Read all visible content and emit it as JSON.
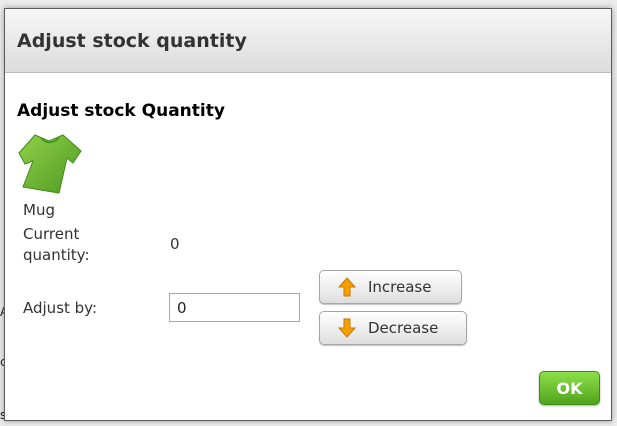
{
  "dialog": {
    "title": "Adjust stock quantity",
    "heading": "Adjust stock Quantity"
  },
  "product": {
    "image_icon": "green-tshirt-icon",
    "name": "Mug"
  },
  "current": {
    "label": "Current quantity:",
    "value": "0"
  },
  "adjust": {
    "label": "Adjust by:",
    "value": "0"
  },
  "buttons": {
    "increase": {
      "label": "Increase",
      "icon": "arrow-up-icon"
    },
    "decrease": {
      "label": "Decrease",
      "icon": "arrow-down-icon"
    },
    "ok": "OK"
  },
  "colors": {
    "ok_button": "#5db62a",
    "arrow": "#f5a000",
    "tshirt": "#6ab331"
  }
}
